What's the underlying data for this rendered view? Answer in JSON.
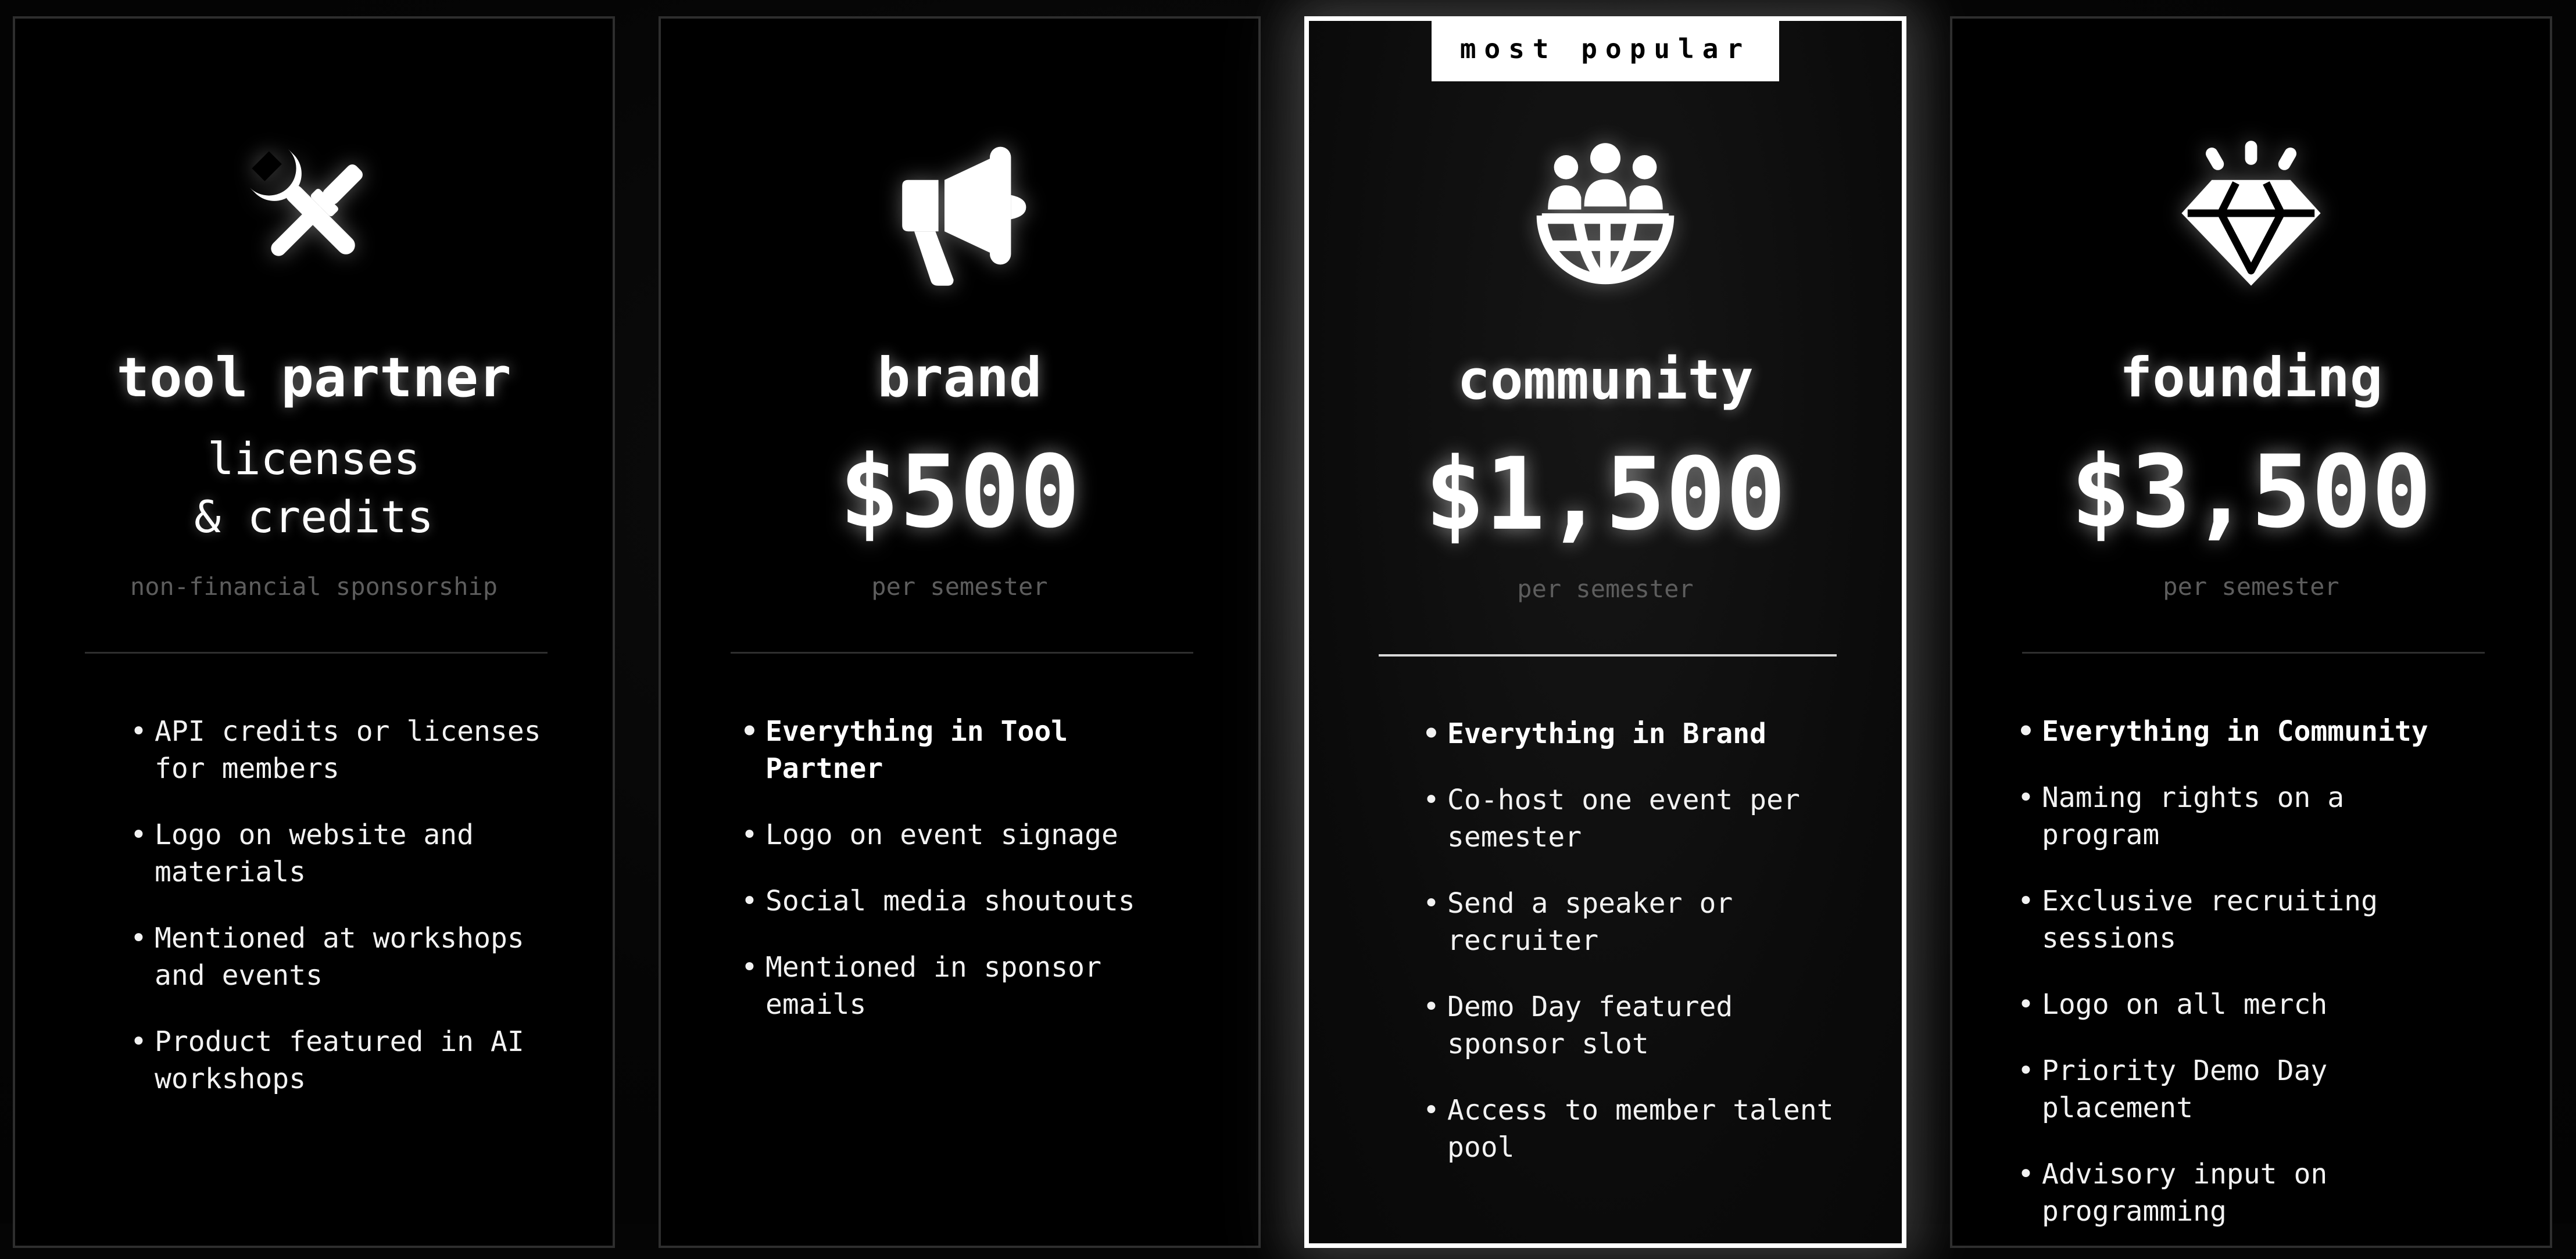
{
  "tiers": [
    {
      "id": "tool-partner",
      "icon": "tools-icon",
      "title": "tool partner",
      "subhead_lines": [
        "licenses",
        "& credits"
      ],
      "note": "non-financial sponsorship",
      "features": [
        "API credits or licenses for members",
        "Logo on website and materials",
        "Mentioned at workshops and events",
        "Product featured in AI workshops"
      ]
    },
    {
      "id": "brand",
      "icon": "megaphone-icon",
      "title": "brand",
      "price": "$500",
      "note": "per semester",
      "features": [
        "Everything in Tool Partner",
        "Logo on event signage",
        "Social media shoutouts",
        "Mentioned in sponsor emails"
      ]
    },
    {
      "id": "community",
      "icon": "community-globe-icon",
      "badge": "most popular",
      "title": "community",
      "price": "$1,500",
      "note": "per semester",
      "features": [
        "Everything in Brand",
        "Co-host one event per semester",
        "Send a speaker or recruiter",
        "Demo Day featured sponsor slot",
        "Access to member talent pool"
      ]
    },
    {
      "id": "founding",
      "icon": "diamond-icon",
      "title": "founding",
      "price": "$3,500",
      "note": "per semester",
      "features": [
        "Everything in Community",
        "Naming rights on a program",
        "Exclusive recruiting sessions",
        "Logo on all merch",
        "Priority Demo Day placement",
        "Advisory input on programming"
      ]
    }
  ]
}
